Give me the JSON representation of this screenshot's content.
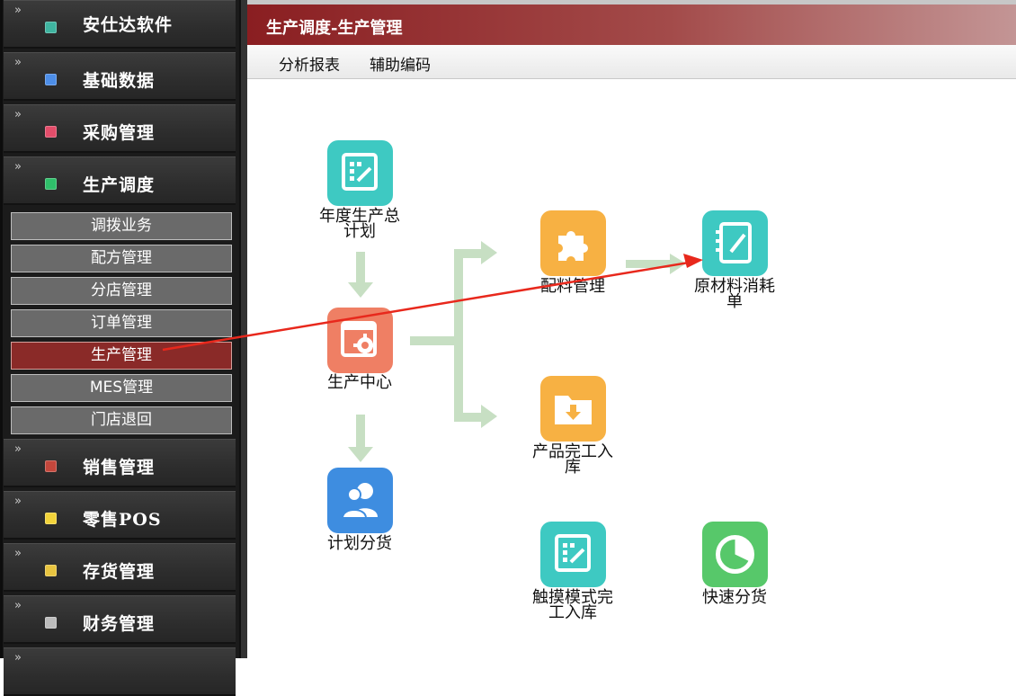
{
  "sidebar": {
    "menus": [
      {
        "label": "安仕达软件",
        "icon": "teal-square-icon",
        "color": "#3fb4a0",
        "expanded": false
      },
      {
        "label": "基础数据",
        "icon": "blue-square-icon",
        "color": "#4d8ee8",
        "expanded": false
      },
      {
        "label": "采购管理",
        "icon": "pink-square-icon",
        "color": "#e34d6a",
        "expanded": false
      },
      {
        "label": "生产调度",
        "icon": "green-square-icon",
        "color": "#2fbf6a",
        "expanded": true
      },
      {
        "label": "销售管理",
        "icon": "red-square-icon",
        "color": "#c4473c",
        "expanded": false
      },
      {
        "label": "零售POS",
        "icon": "yellow-square-icon",
        "color": "#f2d33a",
        "expanded": false
      },
      {
        "label": "存货管理",
        "icon": "gold-square-icon",
        "color": "#e8c440",
        "expanded": false
      },
      {
        "label": "财务管理",
        "icon": "gray-square-icon",
        "color": "#bcbcbc",
        "expanded": false
      }
    ],
    "subitems": [
      {
        "label": "调拨业务",
        "active": false
      },
      {
        "label": "配方管理",
        "active": false
      },
      {
        "label": "分店管理",
        "active": false
      },
      {
        "label": "订单管理",
        "active": false
      },
      {
        "label": "生产管理",
        "active": true
      },
      {
        "label": "MES管理",
        "active": false
      },
      {
        "label": "门店退回",
        "active": false
      }
    ]
  },
  "header": {
    "title": "生产调度-生产管理"
  },
  "toolbar": {
    "items": [
      "分析报表",
      "辅助编码"
    ]
  },
  "nodes": [
    {
      "id": "annual-plan",
      "label_lines": [
        "年度生产总",
        "计划"
      ],
      "icon": "edit-grid-icon",
      "color": "#3ec9c2"
    },
    {
      "id": "production-center",
      "label_lines": [
        "生产中心"
      ],
      "icon": "gear-window-icon",
      "color": "#ef7f64"
    },
    {
      "id": "plan-distribution",
      "label_lines": [
        "计划分货"
      ],
      "icon": "users-icon",
      "color": "#3e8de0"
    },
    {
      "id": "batching",
      "label_lines": [
        "配料管理"
      ],
      "icon": "puzzle-icon",
      "color": "#f7b143"
    },
    {
      "id": "material-consumption",
      "label_lines": [
        "原材料消耗",
        "单"
      ],
      "icon": "notebook-edit-icon",
      "color": "#3ec9c2"
    },
    {
      "id": "product-warehousing",
      "label_lines": [
        "产品完工入",
        "库"
      ],
      "icon": "folder-download-icon",
      "color": "#f7b143"
    },
    {
      "id": "touch-warehousing",
      "label_lines": [
        "触摸模式完",
        "工入库"
      ],
      "icon": "edit-grid-icon",
      "color": "#3ec9c2"
    },
    {
      "id": "quick-distribution",
      "label_lines": [
        "快速分货"
      ],
      "icon": "pie-chart-icon",
      "color": "#57c86a"
    }
  ],
  "colors": {
    "flow_arrow": "#c7dfc3",
    "annotation_arrow": "#e8281c"
  }
}
